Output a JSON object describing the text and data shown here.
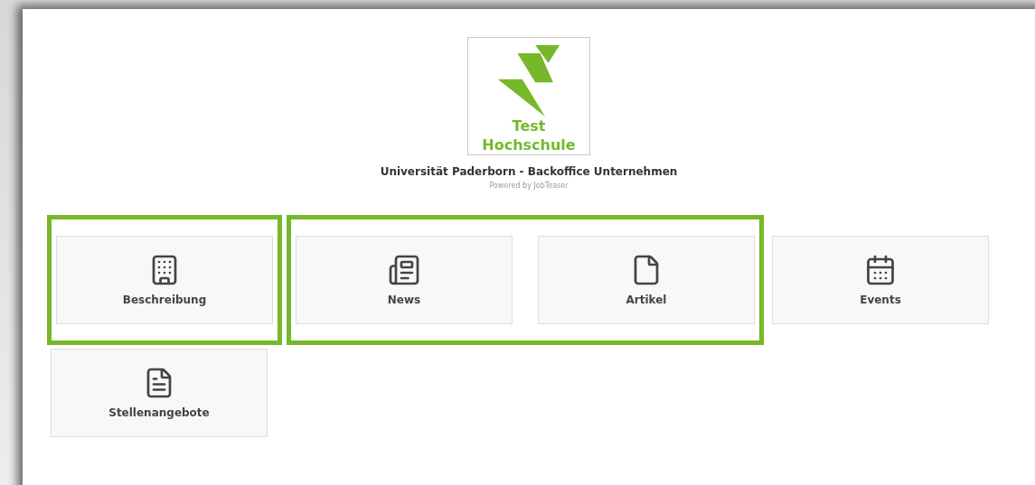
{
  "logo": {
    "lines": [
      "Test",
      "Hochschule"
    ]
  },
  "title": "Universität Paderborn - Backoffice Unternehmen",
  "powered_by": "Powered by JobTeaser",
  "tile_groups": [
    {
      "highlighted": true,
      "tiles": [
        {
          "label": "Beschreibung",
          "kind": "building"
        }
      ]
    },
    {
      "highlighted": true,
      "tiles": [
        {
          "label": "News",
          "kind": "newspaper"
        },
        {
          "label": "Artikel",
          "kind": "file"
        }
      ]
    },
    {
      "highlighted": false,
      "tiles": [
        {
          "label": "Events",
          "kind": "calendar"
        },
        {
          "label": "Stellenangebote",
          "kind": "document"
        }
      ]
    }
  ]
}
